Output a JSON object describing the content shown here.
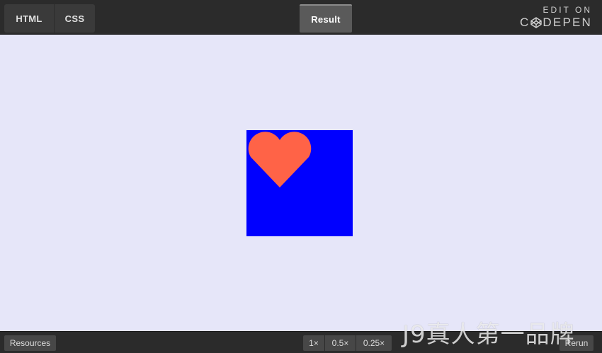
{
  "tabs": {
    "html_label": "HTML",
    "css_label": "CSS",
    "result_label": "Result"
  },
  "brand": {
    "edit_on": "EDIT ON",
    "logo_left": "C",
    "logo_right": "DEPEN"
  },
  "preview": {
    "box_color": "#0000ff",
    "heart_color": "#ff6347",
    "background_color": "#e6e6f9"
  },
  "bottom": {
    "resources_label": "Resources",
    "zoom_1": "1×",
    "zoom_05": "0.5×",
    "zoom_025": "0.25×",
    "rerun_label": "Rerun"
  },
  "watermark": "J9真人第一品牌"
}
